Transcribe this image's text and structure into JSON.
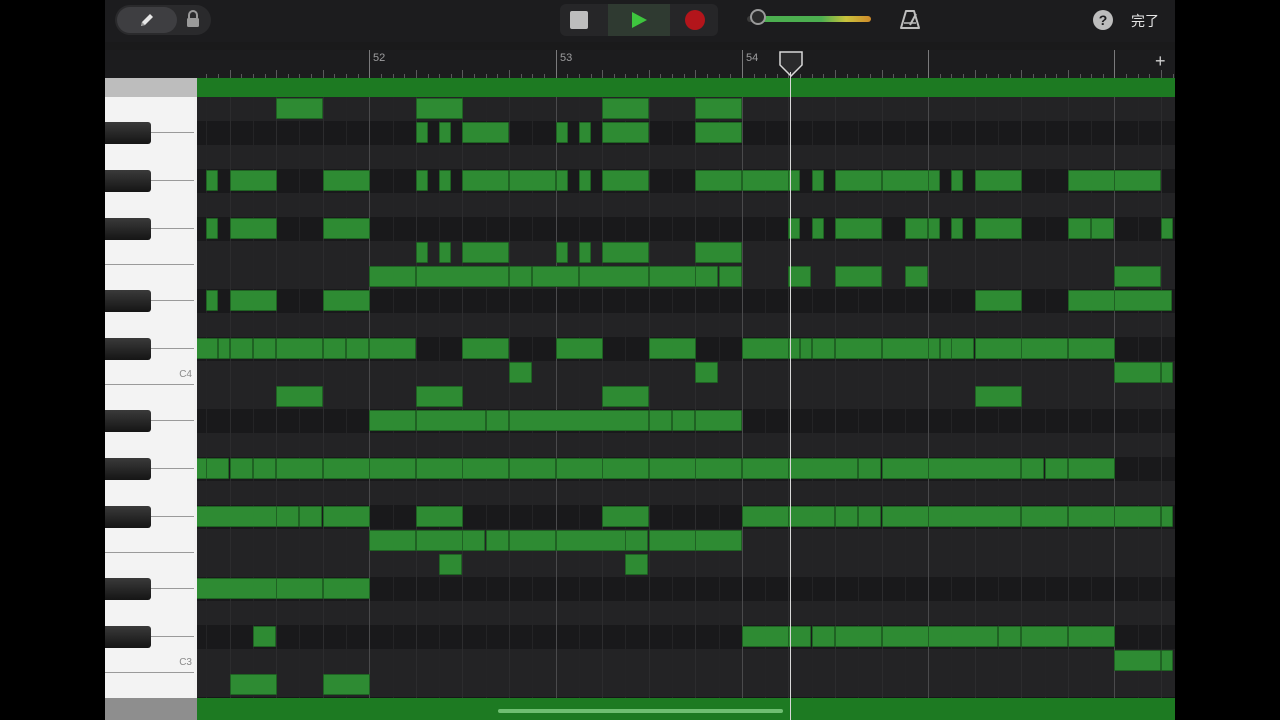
{
  "toolbar": {
    "done_label": "完了",
    "help_label": "?"
  },
  "ruler": {
    "bars": [
      {
        "label": "52",
        "beat": 0
      },
      {
        "label": "53",
        "beat": 4
      },
      {
        "label": "54",
        "beat": 8
      }
    ],
    "add_label": "+"
  },
  "keyboard": {
    "c4_label": "C4",
    "c3_label": "C3"
  },
  "piano_roll": {
    "top_midi": 71,
    "lane_count": 25,
    "visible_start_beat": -3.7,
    "visible_beats": 21,
    "playhead_beat": 2.7,
    "note_color": "#2e8b33",
    "notes": [
      {
        "midi": 71,
        "start": -2,
        "len": 1
      },
      {
        "midi": 71,
        "start": 1,
        "len": 1
      },
      {
        "midi": 71,
        "start": 5,
        "len": 1
      },
      {
        "midi": 71,
        "start": 7,
        "len": 1
      },
      {
        "midi": 70,
        "start": 1,
        "len": 0.25
      },
      {
        "midi": 70,
        "start": 1.5,
        "len": 0.25
      },
      {
        "midi": 70,
        "start": 2,
        "len": 1
      },
      {
        "midi": 70,
        "start": 4,
        "len": 0.25
      },
      {
        "midi": 70,
        "start": 4.5,
        "len": 0.25
      },
      {
        "midi": 70,
        "start": 5,
        "len": 1
      },
      {
        "midi": 70,
        "start": 7,
        "len": 1
      },
      {
        "midi": 68,
        "start": -3.5,
        "len": 0.25
      },
      {
        "midi": 68,
        "start": -3,
        "len": 1
      },
      {
        "midi": 68,
        "start": -1,
        "len": 1
      },
      {
        "midi": 68,
        "start": 1,
        "len": 0.25
      },
      {
        "midi": 68,
        "start": 1.5,
        "len": 0.25
      },
      {
        "midi": 68,
        "start": 2,
        "len": 1
      },
      {
        "midi": 68,
        "start": 3,
        "len": 1
      },
      {
        "midi": 68,
        "start": 4,
        "len": 0.25
      },
      {
        "midi": 68,
        "start": 4.5,
        "len": 0.25
      },
      {
        "midi": 68,
        "start": 5,
        "len": 1
      },
      {
        "midi": 68,
        "start": 7,
        "len": 1
      },
      {
        "midi": 68,
        "start": 8,
        "len": 1
      },
      {
        "midi": 68,
        "start": 9,
        "len": 0.25
      },
      {
        "midi": 68,
        "start": 9.5,
        "len": 0.25
      },
      {
        "midi": 68,
        "start": 10,
        "len": 1
      },
      {
        "midi": 68,
        "start": 11,
        "len": 1
      },
      {
        "midi": 68,
        "start": 12,
        "len": 0.25
      },
      {
        "midi": 68,
        "start": 12.5,
        "len": 0.25
      },
      {
        "midi": 68,
        "start": 13,
        "len": 1
      },
      {
        "midi": 68,
        "start": 15,
        "len": 1
      },
      {
        "midi": 68,
        "start": 16,
        "len": 1
      },
      {
        "midi": 66,
        "start": -3.5,
        "len": 0.25
      },
      {
        "midi": 66,
        "start": -3,
        "len": 1
      },
      {
        "midi": 66,
        "start": -1,
        "len": 1
      },
      {
        "midi": 66,
        "start": 9,
        "len": 0.25
      },
      {
        "midi": 66,
        "start": 9.5,
        "len": 0.25
      },
      {
        "midi": 66,
        "start": 10,
        "len": 1
      },
      {
        "midi": 66,
        "start": 11.5,
        "len": 0.5
      },
      {
        "midi": 66,
        "start": 12,
        "len": 0.25
      },
      {
        "midi": 66,
        "start": 12.5,
        "len": 0.25
      },
      {
        "midi": 66,
        "start": 13,
        "len": 1
      },
      {
        "midi": 66,
        "start": 15,
        "len": 0.5
      },
      {
        "midi": 66,
        "start": 15.5,
        "len": 0.5
      },
      {
        "midi": 66,
        "start": 17,
        "len": 0.25
      },
      {
        "midi": 65,
        "start": 1,
        "len": 0.25
      },
      {
        "midi": 65,
        "start": 1.5,
        "len": 0.25
      },
      {
        "midi": 65,
        "start": 2,
        "len": 1
      },
      {
        "midi": 65,
        "start": 4,
        "len": 0.25
      },
      {
        "midi": 65,
        "start": 4.5,
        "len": 0.25
      },
      {
        "midi": 65,
        "start": 5,
        "len": 1
      },
      {
        "midi": 65,
        "start": 7,
        "len": 1
      },
      {
        "midi": 64,
        "start": 0,
        "len": 1
      },
      {
        "midi": 64,
        "start": 1,
        "len": 2
      },
      {
        "midi": 64,
        "start": 3,
        "len": 0.5
      },
      {
        "midi": 64,
        "start": 3.5,
        "len": 1
      },
      {
        "midi": 64,
        "start": 4.5,
        "len": 1.5
      },
      {
        "midi": 64,
        "start": 6,
        "len": 1
      },
      {
        "midi": 64,
        "start": 7,
        "len": 0.5
      },
      {
        "midi": 64,
        "start": 7.5,
        "len": 0.5
      },
      {
        "midi": 64,
        "start": 9,
        "len": 0.5
      },
      {
        "midi": 64,
        "start": 10,
        "len": 1
      },
      {
        "midi": 64,
        "start": 11.5,
        "len": 0.5
      },
      {
        "midi": 64,
        "start": 16,
        "len": 1
      },
      {
        "midi": 63,
        "start": -3.5,
        "len": 0.25
      },
      {
        "midi": 63,
        "start": -3,
        "len": 1
      },
      {
        "midi": 63,
        "start": -1,
        "len": 1
      },
      {
        "midi": 63,
        "start": 13,
        "len": 1
      },
      {
        "midi": 63,
        "start": 15,
        "len": 1
      },
      {
        "midi": 63,
        "start": 16,
        "len": 1.25
      },
      {
        "midi": 61,
        "start": -3.75,
        "len": 0.5
      },
      {
        "midi": 61,
        "start": -3.25,
        "len": 0.25
      },
      {
        "midi": 61,
        "start": -3,
        "len": 0.5
      },
      {
        "midi": 61,
        "start": -2.5,
        "len": 0.5
      },
      {
        "midi": 61,
        "start": -2,
        "len": 1
      },
      {
        "midi": 61,
        "start": -1,
        "len": 0.5
      },
      {
        "midi": 61,
        "start": -0.5,
        "len": 0.5
      },
      {
        "midi": 61,
        "start": 0,
        "len": 1
      },
      {
        "midi": 61,
        "start": 2,
        "len": 1
      },
      {
        "midi": 61,
        "start": 4,
        "len": 1
      },
      {
        "midi": 61,
        "start": 6,
        "len": 1
      },
      {
        "midi": 61,
        "start": 8,
        "len": 1
      },
      {
        "midi": 61,
        "start": 9,
        "len": 0.25
      },
      {
        "midi": 61,
        "start": 9.25,
        "len": 0.25
      },
      {
        "midi": 61,
        "start": 9.5,
        "len": 0.5
      },
      {
        "midi": 61,
        "start": 10,
        "len": 1
      },
      {
        "midi": 61,
        "start": 11,
        "len": 1
      },
      {
        "midi": 61,
        "start": 12,
        "len": 0.25
      },
      {
        "midi": 61,
        "start": 12.25,
        "len": 0.25
      },
      {
        "midi": 61,
        "start": 12.5,
        "len": 0.5
      },
      {
        "midi": 61,
        "start": 13,
        "len": 1
      },
      {
        "midi": 61,
        "start": 14,
        "len": 1
      },
      {
        "midi": 61,
        "start": 15,
        "len": 1
      },
      {
        "midi": 60,
        "start": 3,
        "len": 0.5
      },
      {
        "midi": 60,
        "start": 7,
        "len": 0.5
      },
      {
        "midi": 60,
        "start": 16,
        "len": 1
      },
      {
        "midi": 60,
        "start": 17,
        "len": 0.25
      },
      {
        "midi": 59,
        "start": -2,
        "len": 1
      },
      {
        "midi": 59,
        "start": 1,
        "len": 1
      },
      {
        "midi": 59,
        "start": 5,
        "len": 1
      },
      {
        "midi": 59,
        "start": 13,
        "len": 1
      },
      {
        "midi": 58,
        "start": 0,
        "len": 1
      },
      {
        "midi": 58,
        "start": 1,
        "len": 1.5
      },
      {
        "midi": 58,
        "start": 2.5,
        "len": 0.5
      },
      {
        "midi": 58,
        "start": 3,
        "len": 3
      },
      {
        "midi": 58,
        "start": 6,
        "len": 0.5
      },
      {
        "midi": 58,
        "start": 6.5,
        "len": 0.5
      },
      {
        "midi": 58,
        "start": 7,
        "len": 1
      },
      {
        "midi": 56,
        "start": -3.75,
        "len": 0.25
      },
      {
        "midi": 56,
        "start": -3.5,
        "len": 0.5
      },
      {
        "midi": 56,
        "start": -3,
        "len": 0.5
      },
      {
        "midi": 56,
        "start": -2.5,
        "len": 0.5
      },
      {
        "midi": 56,
        "start": -2,
        "len": 1
      },
      {
        "midi": 56,
        "start": -1,
        "len": 1
      },
      {
        "midi": 56,
        "start": 0,
        "len": 1
      },
      {
        "midi": 56,
        "start": 1,
        "len": 1
      },
      {
        "midi": 56,
        "start": 2,
        "len": 1
      },
      {
        "midi": 56,
        "start": 3,
        "len": 1
      },
      {
        "midi": 56,
        "start": 4,
        "len": 1
      },
      {
        "midi": 56,
        "start": 5,
        "len": 1
      },
      {
        "midi": 56,
        "start": 6,
        "len": 1
      },
      {
        "midi": 56,
        "start": 7,
        "len": 1
      },
      {
        "midi": 56,
        "start": 8,
        "len": 1
      },
      {
        "midi": 56,
        "start": 9,
        "len": 1.5
      },
      {
        "midi": 56,
        "start": 10.5,
        "len": 0.5
      },
      {
        "midi": 56,
        "start": 11,
        "len": 1
      },
      {
        "midi": 56,
        "start": 12,
        "len": 2
      },
      {
        "midi": 56,
        "start": 14,
        "len": 0.5
      },
      {
        "midi": 56,
        "start": 14.5,
        "len": 0.5
      },
      {
        "midi": 56,
        "start": 15,
        "len": 1
      },
      {
        "midi": 54,
        "start": -3.75,
        "len": 1.75
      },
      {
        "midi": 54,
        "start": -2,
        "len": 0.5
      },
      {
        "midi": 54,
        "start": -1.5,
        "len": 0.5
      },
      {
        "midi": 54,
        "start": -1,
        "len": 1
      },
      {
        "midi": 54,
        "start": 1,
        "len": 1
      },
      {
        "midi": 54,
        "start": 5,
        "len": 1
      },
      {
        "midi": 54,
        "start": 8,
        "len": 1
      },
      {
        "midi": 54,
        "start": 9,
        "len": 1
      },
      {
        "midi": 54,
        "start": 10,
        "len": 0.5
      },
      {
        "midi": 54,
        "start": 10.5,
        "len": 0.5
      },
      {
        "midi": 54,
        "start": 11,
        "len": 1
      },
      {
        "midi": 54,
        "start": 12,
        "len": 2
      },
      {
        "midi": 54,
        "start": 14,
        "len": 1
      },
      {
        "midi": 54,
        "start": 15,
        "len": 1
      },
      {
        "midi": 54,
        "start": 16,
        "len": 1
      },
      {
        "midi": 54,
        "start": 17,
        "len": 0.25
      },
      {
        "midi": 53,
        "start": 0,
        "len": 1
      },
      {
        "midi": 53,
        "start": 1,
        "len": 1
      },
      {
        "midi": 53,
        "start": 2,
        "len": 0.5
      },
      {
        "midi": 53,
        "start": 2.5,
        "len": 0.5
      },
      {
        "midi": 53,
        "start": 3,
        "len": 1
      },
      {
        "midi": 53,
        "start": 4,
        "len": 1.5
      },
      {
        "midi": 53,
        "start": 5.5,
        "len": 0.5
      },
      {
        "midi": 53,
        "start": 6,
        "len": 1
      },
      {
        "midi": 53,
        "start": 7,
        "len": 1
      },
      {
        "midi": 52,
        "start": 1.5,
        "len": 0.5
      },
      {
        "midi": 52,
        "start": 5.5,
        "len": 0.5
      },
      {
        "midi": 51,
        "start": -3.75,
        "len": 1.75
      },
      {
        "midi": 51,
        "start": -2,
        "len": 1
      },
      {
        "midi": 51,
        "start": -1,
        "len": 1
      },
      {
        "midi": 49,
        "start": -2.5,
        "len": 0.5
      },
      {
        "midi": 49,
        "start": 8,
        "len": 1
      },
      {
        "midi": 49,
        "start": 9,
        "len": 0.5
      },
      {
        "midi": 49,
        "start": 9.5,
        "len": 0.5
      },
      {
        "midi": 49,
        "start": 10,
        "len": 1
      },
      {
        "midi": 49,
        "start": 11,
        "len": 1
      },
      {
        "midi": 49,
        "start": 12,
        "len": 1.5
      },
      {
        "midi": 49,
        "start": 13.5,
        "len": 0.5
      },
      {
        "midi": 49,
        "start": 14,
        "len": 1
      },
      {
        "midi": 49,
        "start": 15,
        "len": 1
      },
      {
        "midi": 48,
        "start": 16,
        "len": 1
      },
      {
        "midi": 48,
        "start": 17,
        "len": 0.25
      },
      {
        "midi": 47,
        "start": -3,
        "len": 1
      },
      {
        "midi": 47,
        "start": -1,
        "len": 1
      }
    ]
  }
}
